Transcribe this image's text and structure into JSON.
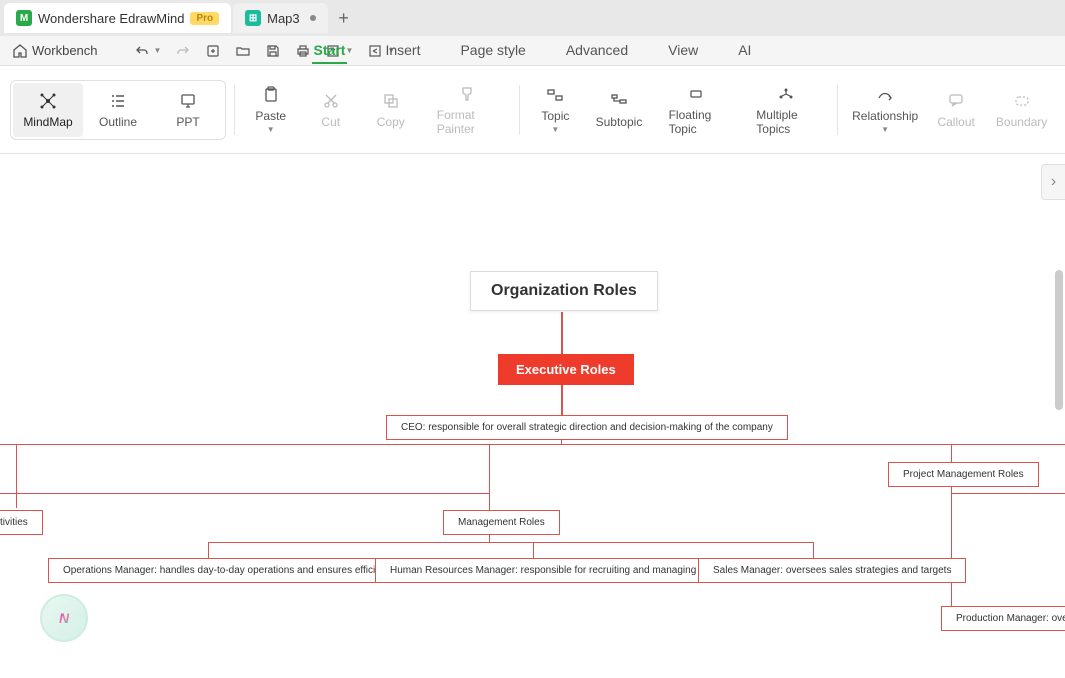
{
  "tabs": {
    "main": "Wondershare EdrawMind",
    "pro": "Pro",
    "doc": "Map3"
  },
  "quickbar": {
    "workbench": "Workbench"
  },
  "menu": {
    "start": "Start",
    "insert": "Insert",
    "pagestyle": "Page style",
    "advanced": "Advanced",
    "view": "View",
    "ai": "AI"
  },
  "views": {
    "mindmap": "MindMap",
    "outline": "Outline",
    "ppt": "PPT"
  },
  "ribbon": {
    "paste": "Paste",
    "cut": "Cut",
    "copy": "Copy",
    "formatpainter": "Format Painter",
    "topic": "Topic",
    "subtopic": "Subtopic",
    "floating": "Floating Topic",
    "multiple": "Multiple Topics",
    "relationship": "Relationship",
    "callout": "Callout",
    "boundary": "Boundary"
  },
  "map": {
    "root": "Organization Roles",
    "exec": "Executive Roles",
    "ceo": "CEO: responsible for overall strategic direction and decision-making of the company",
    "pmroles": "Project Management Roles",
    "mgmtroles": "Management Roles",
    "ops": "Operations Manager: handles day-to-day operations and ensures efficiency",
    "hr": "Human Resources Manager: responsible for recruiting and managing staff",
    "sales": "Sales Manager: oversees sales strategies and targets",
    "activities": "ctivities",
    "production": "Production Manager: overs"
  }
}
